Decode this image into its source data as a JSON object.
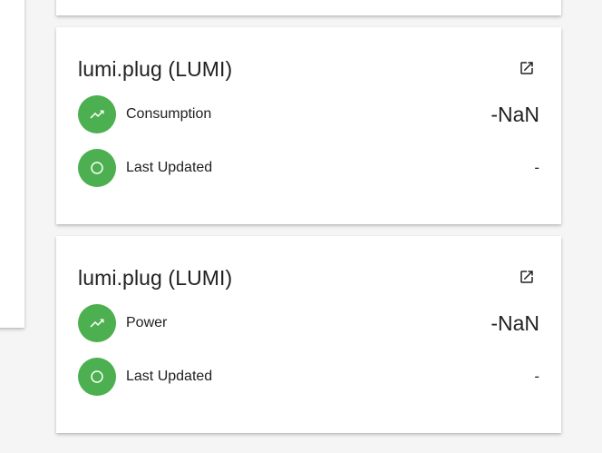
{
  "colors": {
    "badge": "#4caf50",
    "card": "#ffffff",
    "background": "#f5f5f5"
  },
  "cards": [
    {
      "title": "lumi.plug (LUMI)",
      "open_icon": "open-in-new-icon",
      "rows": [
        {
          "icon": "trending-up-icon",
          "label": "Consumption",
          "value": "-NaN"
        },
        {
          "icon": "circle-outline-icon",
          "label": "Last Updated",
          "value": "-"
        }
      ]
    },
    {
      "title": "lumi.plug (LUMI)",
      "open_icon": "open-in-new-icon",
      "rows": [
        {
          "icon": "trending-up-icon",
          "label": "Power",
          "value": "-NaN"
        },
        {
          "icon": "circle-outline-icon",
          "label": "Last Updated",
          "value": "-"
        }
      ]
    }
  ]
}
